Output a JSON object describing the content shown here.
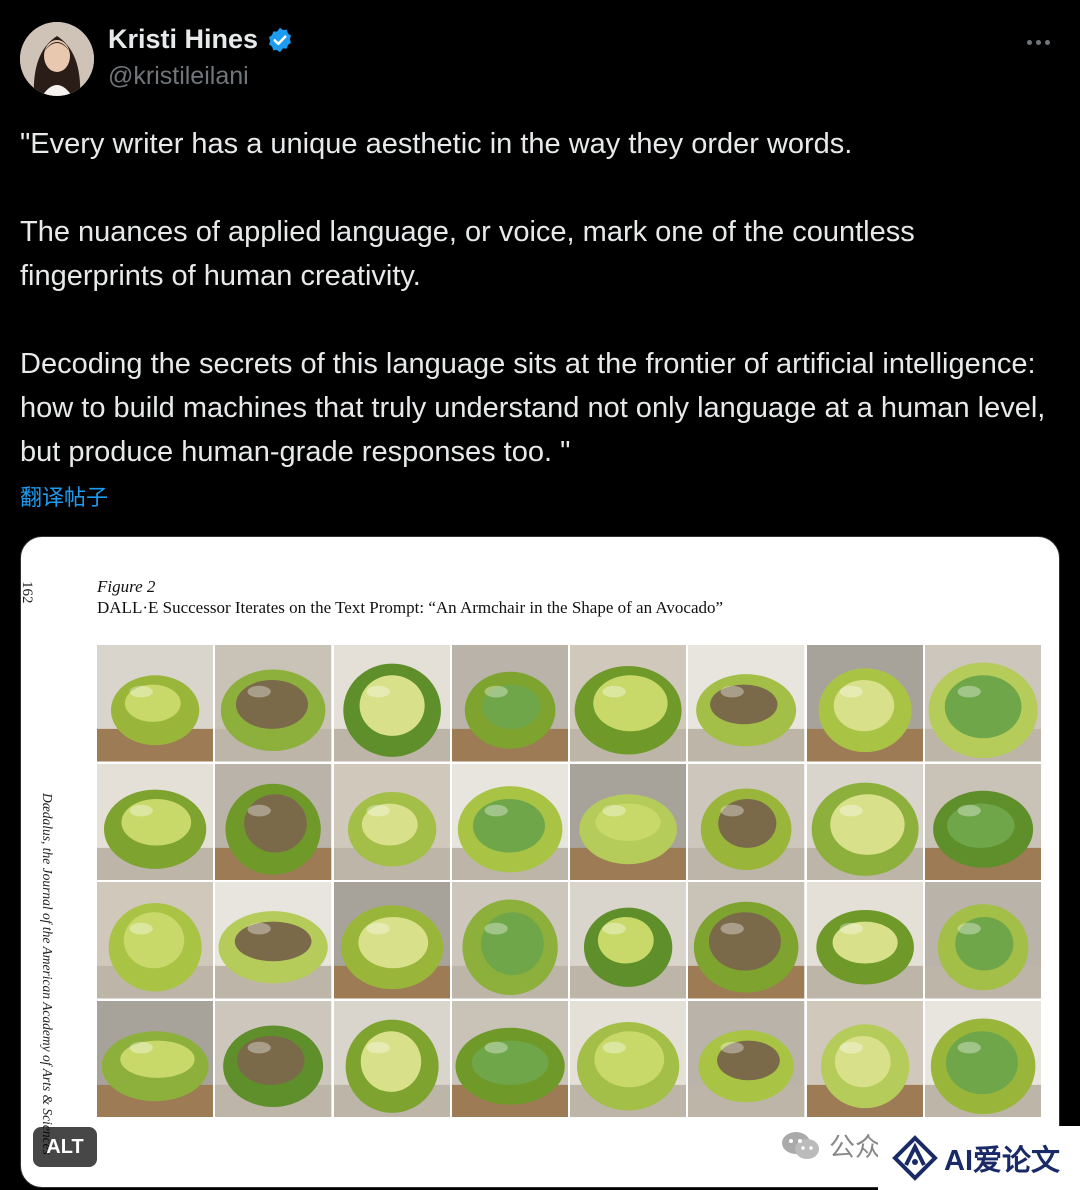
{
  "author": {
    "name": "Kristi Hines",
    "handle": "@kristileilani",
    "verified": true
  },
  "tweet": {
    "paragraph1": "\"Every writer has a unique aesthetic in the way they order words.",
    "paragraph2": "The nuances of applied language, or voice, mark one of the countless fingerprints of human creativity.",
    "paragraph3": "Decoding the secrets of this language sits at the frontier of artificial intelligence: how to build machines that truly understand not only language at a human level, but produce human-grade responses too. \"",
    "translate_label": "翻译帖子"
  },
  "media": {
    "page_number": "162",
    "figure_label": "Figure 2",
    "figure_caption": "DALL·E Successor Iterates on the Text Prompt: “An Armchair in the Shape of an Avocado”",
    "side_text": "Dædalus, the Journal of the American Academy of Arts & Sciences",
    "alt_label": "ALT",
    "grid_rows": 4,
    "grid_cols": 8
  },
  "watermark": {
    "wechat_text": "公众",
    "brand_text": "AI爱论文"
  },
  "colors": {
    "background": "#000000",
    "text": "#e7e9ea",
    "secondary": "#71767b",
    "link": "#1d9bf0",
    "verified": "#1d9bf0"
  },
  "icons": [
    "verified-badge-icon",
    "more-options-icon",
    "wechat-icon",
    "ai-logo-icon"
  ]
}
